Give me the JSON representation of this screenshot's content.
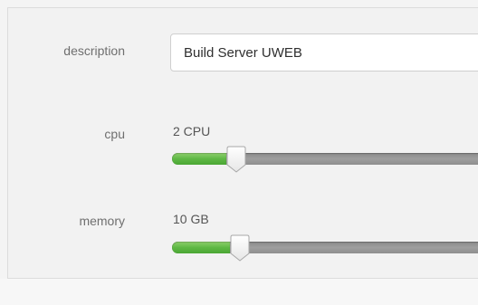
{
  "form": {
    "description": {
      "label": "description",
      "value": "Build Server UWEB"
    },
    "cpu": {
      "label": "cpu",
      "value_text": "2 CPU",
      "level": 0.15
    },
    "memory": {
      "label": "memory",
      "value_text": "10 GB",
      "level": 0.16
    }
  },
  "colors": {
    "fill_green": "#5fb845",
    "track_gray": "#9a9a9a",
    "panel_bg": "#f2f2f2"
  }
}
